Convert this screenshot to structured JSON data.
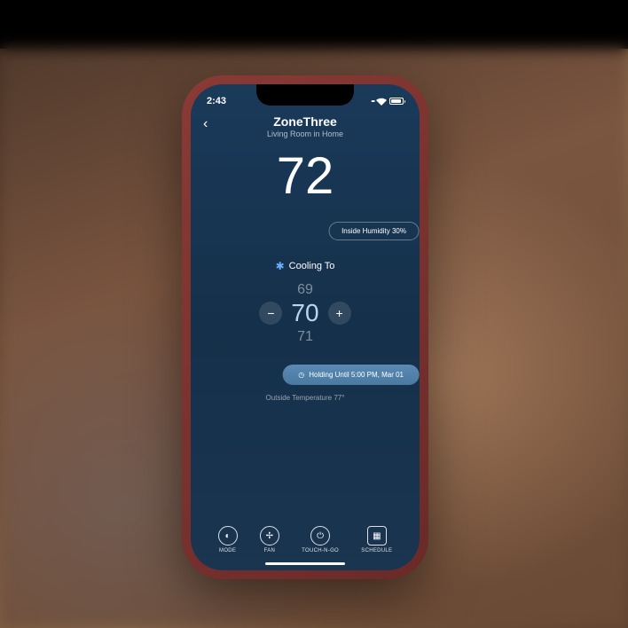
{
  "status": {
    "time": "2:43",
    "menu_dots": "···"
  },
  "header": {
    "back": "‹",
    "title": "ZoneThree",
    "subtitle": "Living Room in Home"
  },
  "current": {
    "temp": "72",
    "degree": "°"
  },
  "humidity": {
    "label": "Inside Humidity 30%"
  },
  "cooling": {
    "label": "Cooling To",
    "above": "69",
    "selected": "70",
    "below": "71",
    "minus": "−",
    "plus": "+"
  },
  "hold": {
    "icon": "◷",
    "label": "Holding Until 5:00 PM, Mar 01"
  },
  "outdoor": {
    "label": "Outside Temperature 77°"
  },
  "nav": {
    "mode": "MODE",
    "fan": "FAN",
    "touchngo": "TOUCH-N-GO",
    "schedule": "SCHEDULE"
  }
}
